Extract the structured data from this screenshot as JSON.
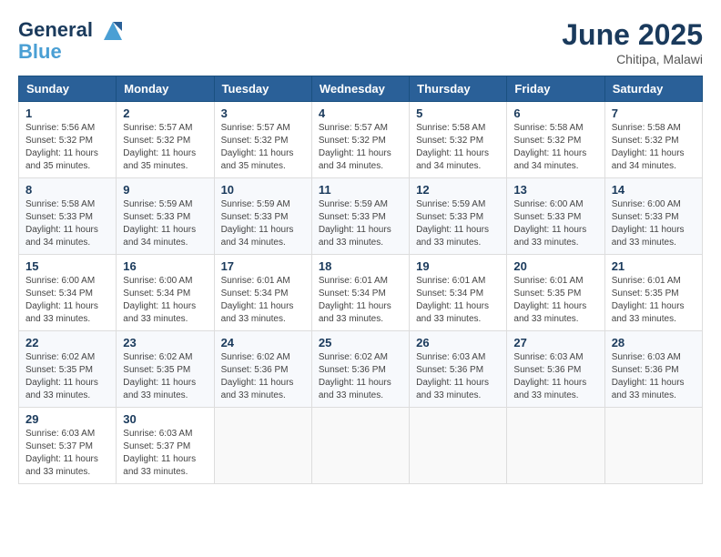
{
  "header": {
    "logo_line1": "General",
    "logo_line2": "Blue",
    "month_year": "June 2025",
    "location": "Chitipa, Malawi"
  },
  "weekdays": [
    "Sunday",
    "Monday",
    "Tuesday",
    "Wednesday",
    "Thursday",
    "Friday",
    "Saturday"
  ],
  "weeks": [
    [
      {
        "day": "1",
        "info": "Sunrise: 5:56 AM\nSunset: 5:32 PM\nDaylight: 11 hours\nand 35 minutes."
      },
      {
        "day": "2",
        "info": "Sunrise: 5:57 AM\nSunset: 5:32 PM\nDaylight: 11 hours\nand 35 minutes."
      },
      {
        "day": "3",
        "info": "Sunrise: 5:57 AM\nSunset: 5:32 PM\nDaylight: 11 hours\nand 35 minutes."
      },
      {
        "day": "4",
        "info": "Sunrise: 5:57 AM\nSunset: 5:32 PM\nDaylight: 11 hours\nand 34 minutes."
      },
      {
        "day": "5",
        "info": "Sunrise: 5:58 AM\nSunset: 5:32 PM\nDaylight: 11 hours\nand 34 minutes."
      },
      {
        "day": "6",
        "info": "Sunrise: 5:58 AM\nSunset: 5:32 PM\nDaylight: 11 hours\nand 34 minutes."
      },
      {
        "day": "7",
        "info": "Sunrise: 5:58 AM\nSunset: 5:32 PM\nDaylight: 11 hours\nand 34 minutes."
      }
    ],
    [
      {
        "day": "8",
        "info": "Sunrise: 5:58 AM\nSunset: 5:33 PM\nDaylight: 11 hours\nand 34 minutes."
      },
      {
        "day": "9",
        "info": "Sunrise: 5:59 AM\nSunset: 5:33 PM\nDaylight: 11 hours\nand 34 minutes."
      },
      {
        "day": "10",
        "info": "Sunrise: 5:59 AM\nSunset: 5:33 PM\nDaylight: 11 hours\nand 34 minutes."
      },
      {
        "day": "11",
        "info": "Sunrise: 5:59 AM\nSunset: 5:33 PM\nDaylight: 11 hours\nand 33 minutes."
      },
      {
        "day": "12",
        "info": "Sunrise: 5:59 AM\nSunset: 5:33 PM\nDaylight: 11 hours\nand 33 minutes."
      },
      {
        "day": "13",
        "info": "Sunrise: 6:00 AM\nSunset: 5:33 PM\nDaylight: 11 hours\nand 33 minutes."
      },
      {
        "day": "14",
        "info": "Sunrise: 6:00 AM\nSunset: 5:33 PM\nDaylight: 11 hours\nand 33 minutes."
      }
    ],
    [
      {
        "day": "15",
        "info": "Sunrise: 6:00 AM\nSunset: 5:34 PM\nDaylight: 11 hours\nand 33 minutes."
      },
      {
        "day": "16",
        "info": "Sunrise: 6:00 AM\nSunset: 5:34 PM\nDaylight: 11 hours\nand 33 minutes."
      },
      {
        "day": "17",
        "info": "Sunrise: 6:01 AM\nSunset: 5:34 PM\nDaylight: 11 hours\nand 33 minutes."
      },
      {
        "day": "18",
        "info": "Sunrise: 6:01 AM\nSunset: 5:34 PM\nDaylight: 11 hours\nand 33 minutes."
      },
      {
        "day": "19",
        "info": "Sunrise: 6:01 AM\nSunset: 5:34 PM\nDaylight: 11 hours\nand 33 minutes."
      },
      {
        "day": "20",
        "info": "Sunrise: 6:01 AM\nSunset: 5:35 PM\nDaylight: 11 hours\nand 33 minutes."
      },
      {
        "day": "21",
        "info": "Sunrise: 6:01 AM\nSunset: 5:35 PM\nDaylight: 11 hours\nand 33 minutes."
      }
    ],
    [
      {
        "day": "22",
        "info": "Sunrise: 6:02 AM\nSunset: 5:35 PM\nDaylight: 11 hours\nand 33 minutes."
      },
      {
        "day": "23",
        "info": "Sunrise: 6:02 AM\nSunset: 5:35 PM\nDaylight: 11 hours\nand 33 minutes."
      },
      {
        "day": "24",
        "info": "Sunrise: 6:02 AM\nSunset: 5:36 PM\nDaylight: 11 hours\nand 33 minutes."
      },
      {
        "day": "25",
        "info": "Sunrise: 6:02 AM\nSunset: 5:36 PM\nDaylight: 11 hours\nand 33 minutes."
      },
      {
        "day": "26",
        "info": "Sunrise: 6:03 AM\nSunset: 5:36 PM\nDaylight: 11 hours\nand 33 minutes."
      },
      {
        "day": "27",
        "info": "Sunrise: 6:03 AM\nSunset: 5:36 PM\nDaylight: 11 hours\nand 33 minutes."
      },
      {
        "day": "28",
        "info": "Sunrise: 6:03 AM\nSunset: 5:36 PM\nDaylight: 11 hours\nand 33 minutes."
      }
    ],
    [
      {
        "day": "29",
        "info": "Sunrise: 6:03 AM\nSunset: 5:37 PM\nDaylight: 11 hours\nand 33 minutes."
      },
      {
        "day": "30",
        "info": "Sunrise: 6:03 AM\nSunset: 5:37 PM\nDaylight: 11 hours\nand 33 minutes."
      },
      {
        "day": "",
        "info": ""
      },
      {
        "day": "",
        "info": ""
      },
      {
        "day": "",
        "info": ""
      },
      {
        "day": "",
        "info": ""
      },
      {
        "day": "",
        "info": ""
      }
    ]
  ]
}
